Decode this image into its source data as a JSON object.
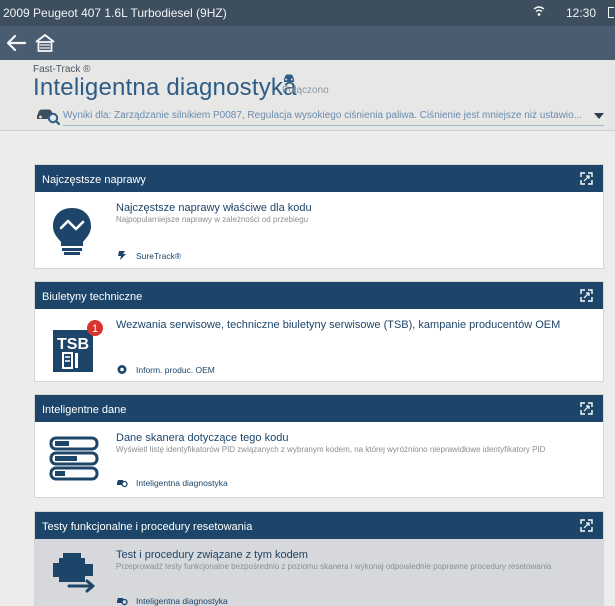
{
  "statusbar": {
    "vehicle": "2009 Peugeot 407 1.6L Turbodiesel (9HZ)",
    "time": "12:30",
    "wifi_icon": "wifi-icon",
    "battery_icon": "battery-icon"
  },
  "navbar": {
    "back_icon": "back-arrow-icon",
    "home_icon": "home-icon"
  },
  "header": {
    "brand": "Fast-Track ®",
    "title": "Inteligentna diagnostyka",
    "connection": "Połączono",
    "results": "Wyniki dla: Zarządzanie silnikiem P0087, Regulacja wysokiego ciśnienia paliwa. Ciśnienie jest mniejsze niż ustawio...",
    "accent": "#2e5c86"
  },
  "cards": [
    {
      "header": "Najczęstsze naprawy",
      "title": "Najczęstsze naprawy właściwe dla kodu",
      "desc": "Najpopularniejsze naprawy w zależności od przebiegu",
      "link": "SureTrack®",
      "icon": "lightbulb-icon"
    },
    {
      "header": "Biuletyny techniczne",
      "title": "Wezwania serwisowe, techniczne biuletyny serwisowe (TSB), kampanie producentów OEM",
      "desc": "",
      "link": "Inform. produc. OEM",
      "icon": "tsb-document-icon",
      "badge_text": "TSB",
      "badge": "1"
    },
    {
      "header": "Inteligentne dane",
      "title": "Dane skanera dotyczące tego kodu",
      "desc": "Wyświetl listę identyfikatorów PID związanych z wybranym kodem, na której wyróżniono nieprawidłowe identyfikatory PID",
      "link": "Inteligentna diagnostyka",
      "icon": "data-list-icon"
    },
    {
      "header": "Testy funkcjonalne i procedury resetowania",
      "title": "Test i procedury związane z tym kodem",
      "desc": "Przeprowadź testy funkcjonalne bezpośrednio z poziomu skanera i wykonaj odpowiednie poprawne procedury resetowania",
      "link": "Inteligentna diagnostyka",
      "icon": "engine-icon"
    }
  ],
  "colors": {
    "card_header": "#1d4569",
    "status_bar": "#3d4e5e",
    "badge": "#d9342b"
  }
}
